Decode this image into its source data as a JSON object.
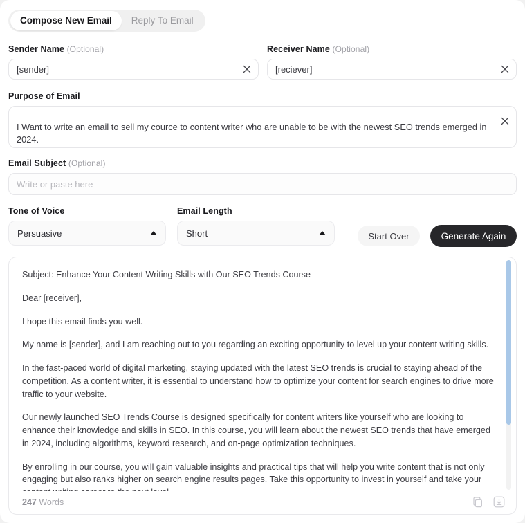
{
  "tabs": [
    {
      "label": "Compose New Email",
      "active": true
    },
    {
      "label": "Reply To Email",
      "active": false
    }
  ],
  "fields": {
    "sender": {
      "label": "Sender Name",
      "optional": "(Optional)",
      "value": "[sender]",
      "clear_icon": "close-icon"
    },
    "receiver": {
      "label": "Receiver Name",
      "optional": "(Optional)",
      "value": "[reciever]",
      "clear_icon": "close-icon"
    },
    "purpose": {
      "label": "Purpose of Email",
      "value": "I Want to write an email to sell my cource to content writer who are unable to be with the newest SEO trends emerged in 2024.",
      "clear_icon": "close-icon"
    },
    "subject": {
      "label": "Email Subject",
      "optional": "(Optional)",
      "value": "",
      "placeholder": "Write or paste here"
    },
    "tone": {
      "label": "Tone of Voice",
      "selected": "Persuasive",
      "caret_icon": "caret-up-icon"
    },
    "length": {
      "label": "Email Length",
      "selected": "Short",
      "caret_icon": "caret-up-icon"
    }
  },
  "actions": {
    "start_over": "Start Over",
    "generate_again": "Generate Again"
  },
  "output": {
    "paragraphs": [
      "Subject: Enhance Your Content Writing Skills with Our SEO Trends Course",
      "Dear [receiver],",
      "I hope this email finds you well.",
      "My name is [sender], and I am reaching out to you regarding an exciting opportunity to level up your content writing skills.",
      "In the fast-paced world of digital marketing, staying updated with the latest SEO trends is crucial to staying ahead of the competition. As a content writer, it is essential to understand how to optimize your content for search engines to drive more traffic to your website.",
      "Our newly launched SEO Trends Course is designed specifically for content writers like yourself who are looking to enhance their knowledge and skills in SEO. In this course, you will learn about the newest SEO trends that have emerged in 2024, including algorithms, keyword research, and on-page optimization techniques.",
      "By enrolling in our course, you will gain valuable insights and practical tips that will help you write content that is not only engaging but also ranks higher on search engine results pages. Take this opportunity to invest in yourself and take your content writing career to the next level."
    ],
    "word_count_number": "247",
    "word_count_unit": " Words",
    "copy_icon": "copy-icon",
    "download_icon": "download-icon"
  },
  "colors": {
    "accent_dark": "#27272a",
    "scrollbar": "#a9c8e8",
    "border": "#e6e6e9",
    "muted_text": "#a2a2a8"
  }
}
